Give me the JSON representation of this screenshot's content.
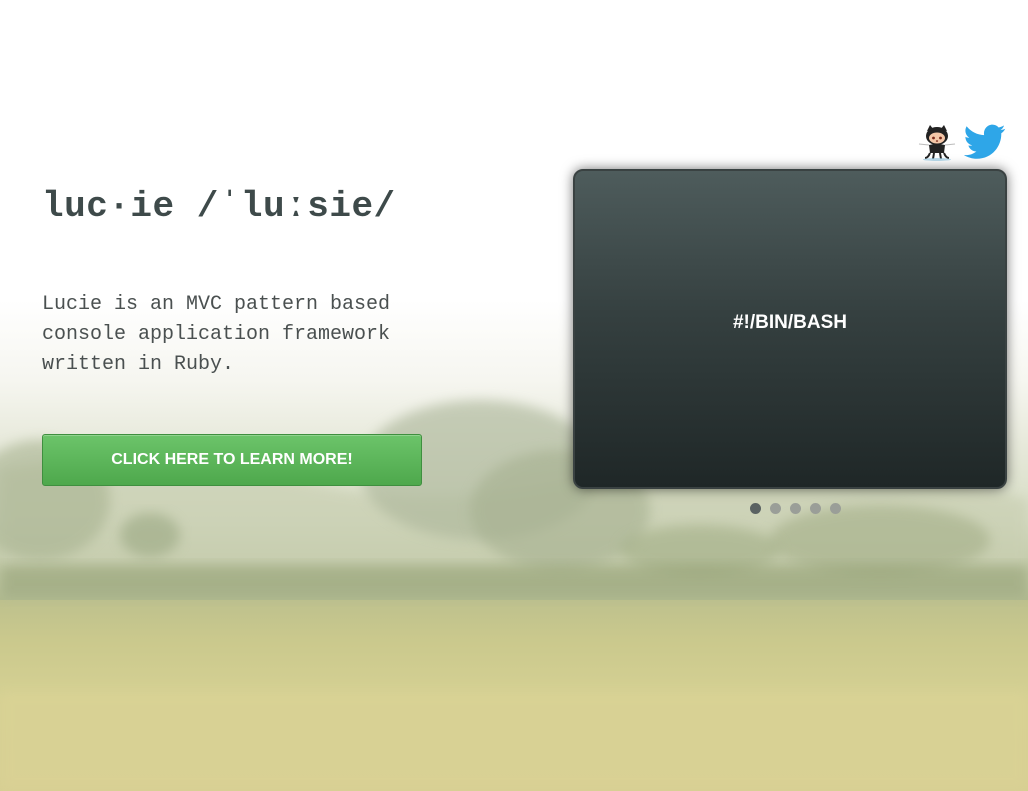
{
  "hero": {
    "title": "luc·ie /ˈluːsie/",
    "description": "Lucie is an MVC pattern based console application framework written in Ruby.",
    "cta_label": "CLICK HERE TO LEARN MORE!"
  },
  "social": {
    "icons": [
      "github-octocat-icon",
      "twitter-bird-icon"
    ],
    "twitter_color": "#2ea6e8"
  },
  "slider": {
    "current_slide_text": "#!/BIN/BASH",
    "slide_count": 5,
    "active_index": 0
  },
  "colors": {
    "cta_green": "#5cb85c",
    "title_color": "#3e4a4a",
    "slider_bg": "#2e3838"
  }
}
